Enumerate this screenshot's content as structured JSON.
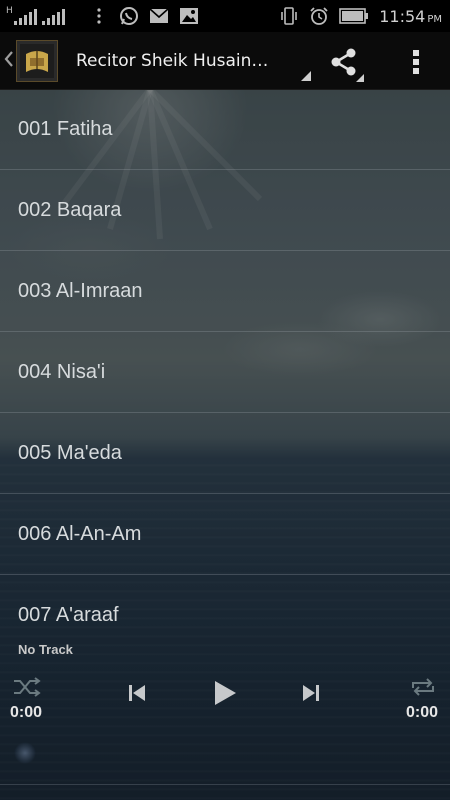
{
  "status_bar": {
    "network_label": "H",
    "time": "11:54",
    "ampm": "PM"
  },
  "app_bar": {
    "title": "Recitor Sheik Husain…",
    "back_icon": "chevron-left-icon",
    "app_icon": "quran-app-icon",
    "share_icon": "share-icon",
    "overflow_icon": "overflow-menu-icon"
  },
  "tracks": [
    "001 Fatiha",
    "002 Baqara",
    "003 Al-Imraan",
    "004 Nisa'i",
    "005 Ma'eda",
    "006 Al-An-Am",
    "007 A'araaf"
  ],
  "player": {
    "now_playing": "No Track",
    "current_time": "0:00",
    "total_time": "0:00",
    "progress": 0
  },
  "colors": {
    "status_bg": "#000000",
    "appbar_bg": "#0b0b0b",
    "text": "#d7dbdd",
    "divider": "#7f8a90"
  }
}
